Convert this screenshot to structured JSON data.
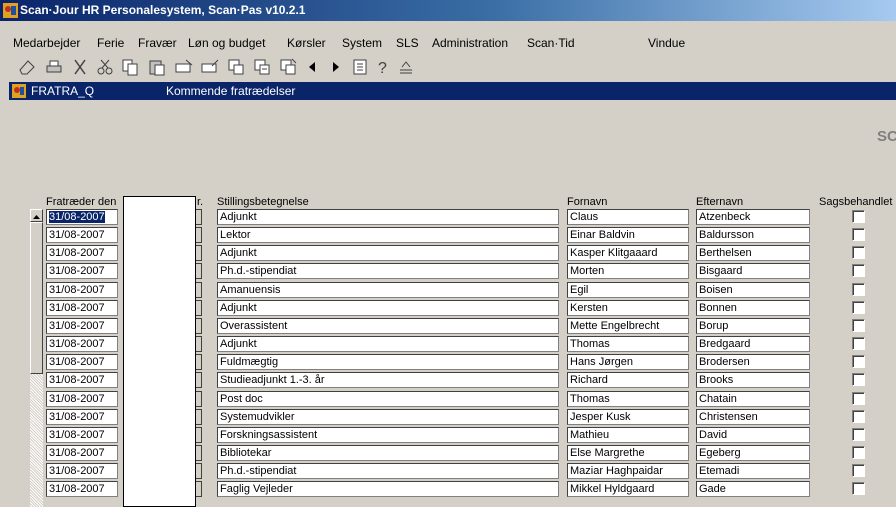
{
  "window": {
    "title": "Scan·Jour HR Personalesystem, Scan·Pas  v10.2.1"
  },
  "menu": {
    "items": [
      "Medarbejder",
      "Ferie",
      "Fravær",
      "Løn og budget",
      "Kørsler",
      "System",
      "SLS",
      "Administration",
      "Scan·Tid",
      "Vindue"
    ]
  },
  "toolbar": {
    "icons": [
      "eraser-icon",
      "print-icon",
      "cut-tool-icon",
      "scissors-icon",
      "copy-icon",
      "paste-icon",
      "insert-record-icon",
      "delete-record-icon",
      "query-icon",
      "query-execute-icon",
      "query-count-icon",
      "previous-icon",
      "next-icon",
      "list-icon",
      "help-icon",
      "exit-icon"
    ]
  },
  "form": {
    "name": "FRATRA_Q",
    "title": "Kommende fratrædelser",
    "brand_fragment": "SC"
  },
  "columns": {
    "date": "Fratræder den",
    "nr": "r.",
    "title": "Stillingsbetegnelse",
    "firstname": "Fornavn",
    "lastname": "Efternavn",
    "handled": "Sagsbehandlet"
  },
  "rows": [
    {
      "date": "31/08-2007",
      "title": "Adjunkt",
      "firstname": "Claus",
      "lastname": "Atzenbeck",
      "handled": false
    },
    {
      "date": "31/08-2007",
      "title": "Lektor",
      "firstname": "Einar Baldvin",
      "lastname": "Baldursson",
      "handled": false
    },
    {
      "date": "31/08-2007",
      "title": "Adjunkt",
      "firstname": "Kasper Klitgaaard",
      "lastname": "Berthelsen",
      "handled": false
    },
    {
      "date": "31/08-2007",
      "title": "Ph.d.-stipendiat",
      "firstname": "Morten",
      "lastname": "Bisgaard",
      "handled": false
    },
    {
      "date": "31/08-2007",
      "title": "Amanuensis",
      "firstname": "Egil",
      "lastname": "Boisen",
      "handled": false
    },
    {
      "date": "31/08-2007",
      "title": "Adjunkt",
      "firstname": "Kersten",
      "lastname": "Bonnen",
      "handled": false
    },
    {
      "date": "31/08-2007",
      "title": "Overassistent",
      "firstname": "Mette Engelbrecht",
      "lastname": "Borup",
      "handled": false
    },
    {
      "date": "31/08-2007",
      "title": "Adjunkt",
      "firstname": "Thomas",
      "lastname": "Bredgaard",
      "handled": false
    },
    {
      "date": "31/08-2007",
      "title": "Fuldmægtig",
      "firstname": "Hans Jørgen",
      "lastname": "Brodersen",
      "handled": false
    },
    {
      "date": "31/08-2007",
      "title": "Studieadjunkt 1.-3. år",
      "firstname": "Richard",
      "lastname": "Brooks",
      "handled": false
    },
    {
      "date": "31/08-2007",
      "title": "Post doc",
      "firstname": "Thomas",
      "lastname": "Chatain",
      "handled": false
    },
    {
      "date": "31/08-2007",
      "title": "Systemudvikler",
      "firstname": "Jesper Kusk",
      "lastname": "Christensen",
      "handled": false
    },
    {
      "date": "31/08-2007",
      "title": "Forskningsassistent",
      "firstname": "Mathieu",
      "lastname": "David",
      "handled": false
    },
    {
      "date": "31/08-2007",
      "title": "Bibliotekar",
      "firstname": "Else Margrethe",
      "lastname": "Egeberg",
      "handled": false
    },
    {
      "date": "31/08-2007",
      "title": "Ph.d.-stipendiat",
      "firstname": "Maziar Haghpaidar",
      "lastname": "Etemadi",
      "handled": false
    },
    {
      "date": "31/08-2007",
      "title": "Faglig Vejleder",
      "firstname": "Mikkel Hyldgaard",
      "lastname": "Gade",
      "handled": false
    }
  ]
}
